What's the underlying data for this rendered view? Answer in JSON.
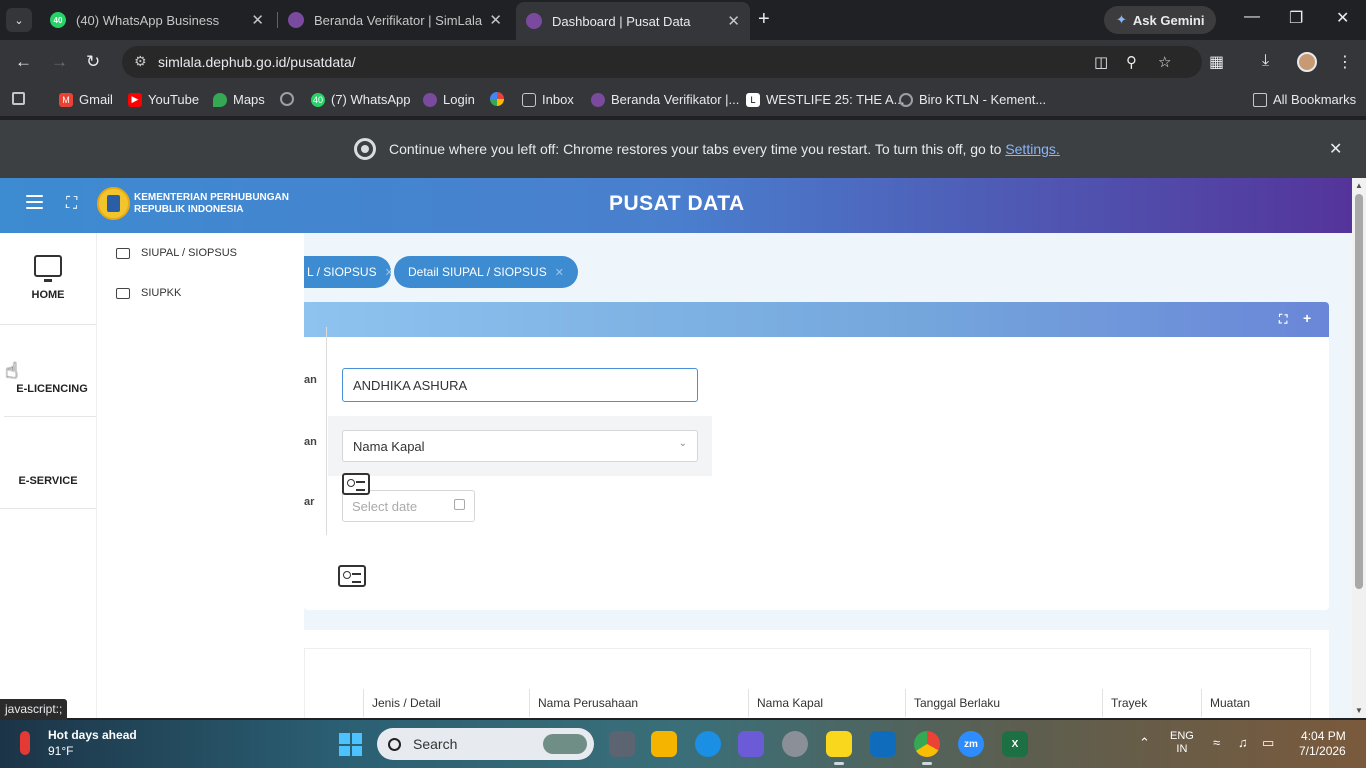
{
  "tabs": [
    {
      "title": "(40) WhatsApp Business",
      "favicon_text": "40",
      "color": "#25d366"
    },
    {
      "title": "Beranda Verifikator | SimLala",
      "favicon_text": "",
      "color": "#7a4a9e"
    },
    {
      "title": "Dashboard | Pusat Data",
      "favicon_text": "",
      "color": "#7a4a9e",
      "active": true
    }
  ],
  "gemini": {
    "label": "Ask Gemini"
  },
  "address": {
    "url": "simlala.dephub.go.id/pusatdata/"
  },
  "bookmarks": [
    {
      "label": "Gmail",
      "color": "#ea4335"
    },
    {
      "label": "YouTube",
      "color": "#ff0000"
    },
    {
      "label": "Maps",
      "color": "#34a853"
    },
    {
      "label": "",
      "color": "#9aa0a6"
    },
    {
      "label": "(7) WhatsApp",
      "color": "#25d366",
      "badge": "40"
    },
    {
      "label": "Login",
      "color": "#7a4a9e"
    },
    {
      "label": "",
      "color": "#fbbc04"
    },
    {
      "label": "Inbox",
      "color": "#9aa0a6"
    },
    {
      "label": "Beranda Verifikator |...",
      "color": "#7a4a9e"
    },
    {
      "label": "WESTLIFE 25: THE A...",
      "color": "#ffffff"
    },
    {
      "label": "Biro KTLN - Kement...",
      "color": "#9aa0a6"
    }
  ],
  "all_bookmarks": "All Bookmarks",
  "infobar": {
    "message": "Continue where you left off: Chrome restores your tabs every time you restart. To turn this off, go to ",
    "link": "Settings."
  },
  "app": {
    "ministry_line1": "KEMENTERIAN PERHUBUNGAN",
    "ministry_line2": "REPUBLIK INDONESIA",
    "title": "PUSAT DATA"
  },
  "sidenav": [
    {
      "label": "HOME",
      "icon": "monitor-icon"
    },
    {
      "label": "E-LICENCING",
      "icon": "id-card-icon"
    },
    {
      "label": "E-SERVICE",
      "icon": "id-card-icon"
    }
  ],
  "submenu": [
    "SIUPAL / SIOPSUS",
    "SIUPKK"
  ],
  "pills": [
    {
      "label": "L / SIOPSUS"
    },
    {
      "label": "Detail SIUPAL / SIOPSUS"
    }
  ],
  "form": {
    "label1": "an",
    "label2": "an",
    "label3": "ar",
    "name_value": "ANDHIKA ASHURA",
    "select_value": "Nama Kapal",
    "date_placeholder": "Select date"
  },
  "table": {
    "headers": [
      "Jenis / Detail",
      "Nama Perusahaan",
      "Nama Kapal",
      "Tanggal Berlaku",
      "Trayek",
      "Muatan"
    ]
  },
  "status_url": "javascript:;",
  "taskbar": {
    "weather_title": "Hot days ahead",
    "weather_temp": "91°F",
    "search_label": "Search",
    "lang_line1": "ENG",
    "lang_line2": "IN",
    "time": "4:04 PM",
    "date": "7/1/2026"
  }
}
